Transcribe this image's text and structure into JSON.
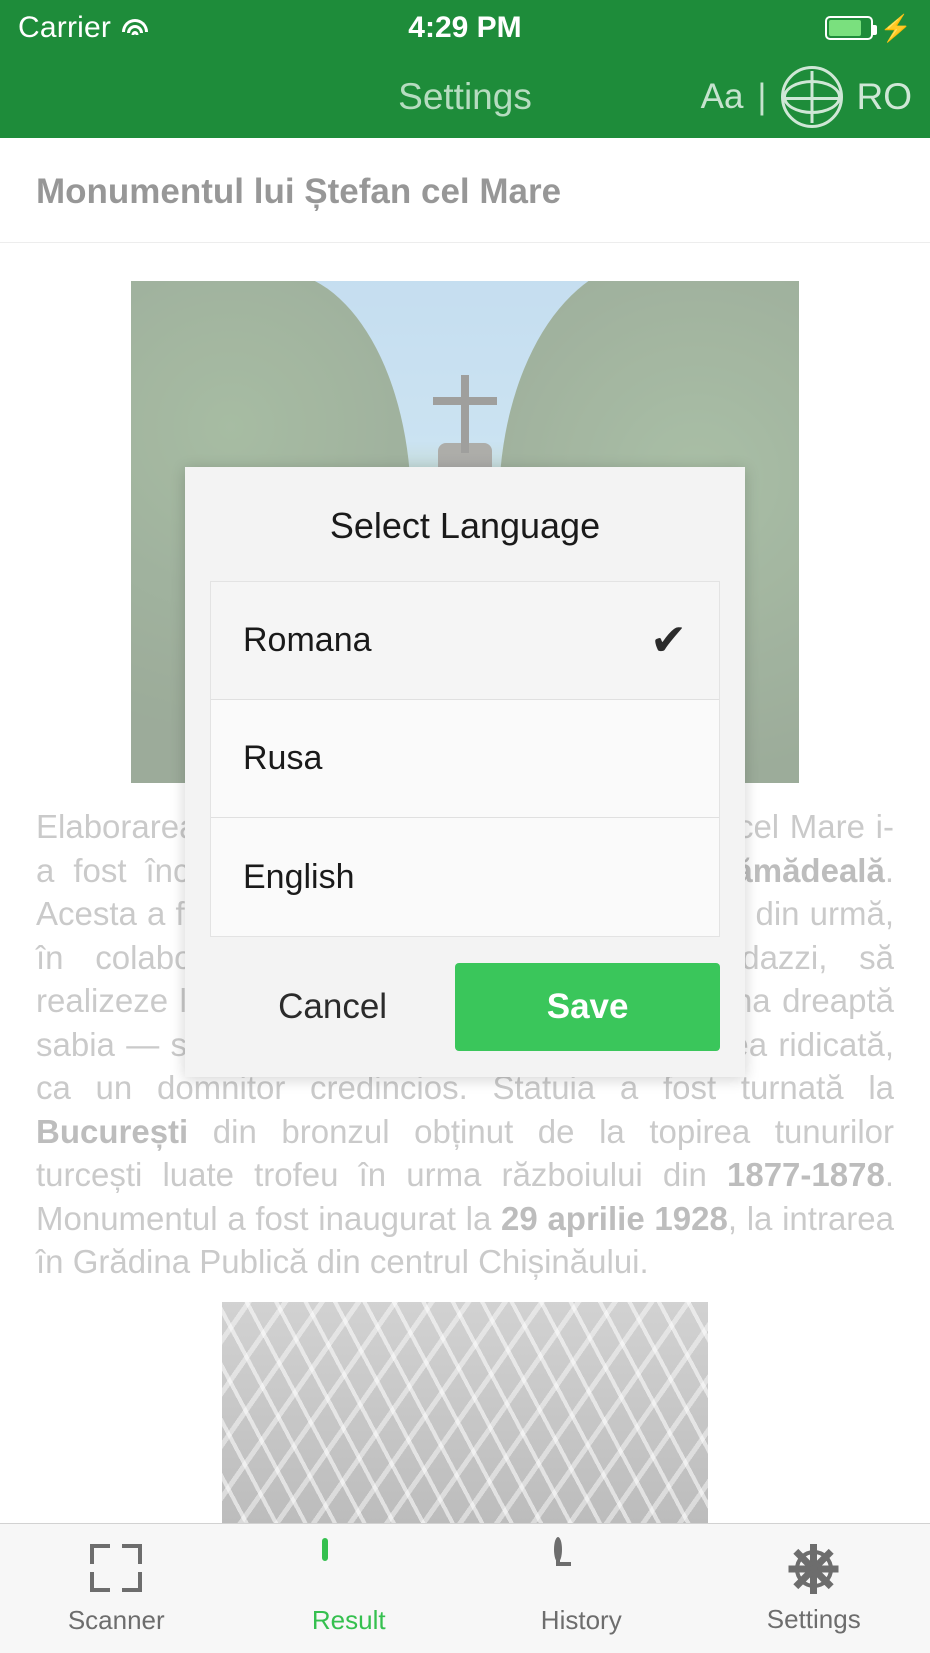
{
  "statusbar": {
    "carrier": "Carrier",
    "wifi_icon": "wifi-icon",
    "time": "4:29 PM",
    "battery_icon": "battery-icon",
    "charging_icon": "lightning-bolt-icon",
    "battery_level": 80
  },
  "navbar": {
    "title": "Settings",
    "font_size_label": "Aa",
    "separator": "|",
    "globe_icon": "globe-icon",
    "language_code": "RO",
    "background_color": "#1e8c3a"
  },
  "document": {
    "title": "Monumentul lui Ștefan cel Mare",
    "hero_image_alt": "monument-photo",
    "body_parts": [
      {
        "text": "Elaborarea proiectului monumentului lui Ștefan cel Mare i-a fost încredințată sculptorului ",
        "bold": false
      },
      {
        "text": "Alexandru Plămădeală",
        "bold": true
      },
      {
        "text": ". Acesta a făcut trei variante, dar s-a oprit, în cele din urmă, în colaborare cu arhitectul Eugen Bernardazzi, să realizeze lucrarea în care domnitorul are în mâna dreaptă sabia — simbol al vitejiei, iar în stânga — crucea ridicată, ca un domnitor credincios. Statuia a fost turnată la ",
        "bold": false
      },
      {
        "text": "București",
        "bold": true
      },
      {
        "text": " din bronzul obținut de la topirea tunurilor turcești luate trofeu în urma războiului din ",
        "bold": false
      },
      {
        "text": "1877-1878",
        "bold": true
      },
      {
        "text": ".  Monumentul a fost inaugurat la ",
        "bold": false
      },
      {
        "text": "29 aprilie 1928",
        "bold": true
      },
      {
        "text": ", la intrarea în Grădina Publică din centrul Chișinăului.",
        "bold": false
      }
    ],
    "second_image_alt": "historic-bw-photo"
  },
  "modal": {
    "title": "Select Language",
    "options": [
      {
        "label": "Romana",
        "selected": true
      },
      {
        "label": "Rusa",
        "selected": false
      },
      {
        "label": "English",
        "selected": false
      }
    ],
    "check_glyph": "✔",
    "cancel_label": "Cancel",
    "save_label": "Save",
    "save_color": "#3ac65b"
  },
  "tabbar": {
    "items": [
      {
        "label": "Scanner",
        "icon": "scanner-icon",
        "active": false
      },
      {
        "label": "Result",
        "icon": "document-icon",
        "active": true
      },
      {
        "label": "History",
        "icon": "clock-icon",
        "active": false
      },
      {
        "label": "Settings",
        "icon": "gear-icon",
        "active": false
      }
    ],
    "active_color": "#35c04f"
  }
}
